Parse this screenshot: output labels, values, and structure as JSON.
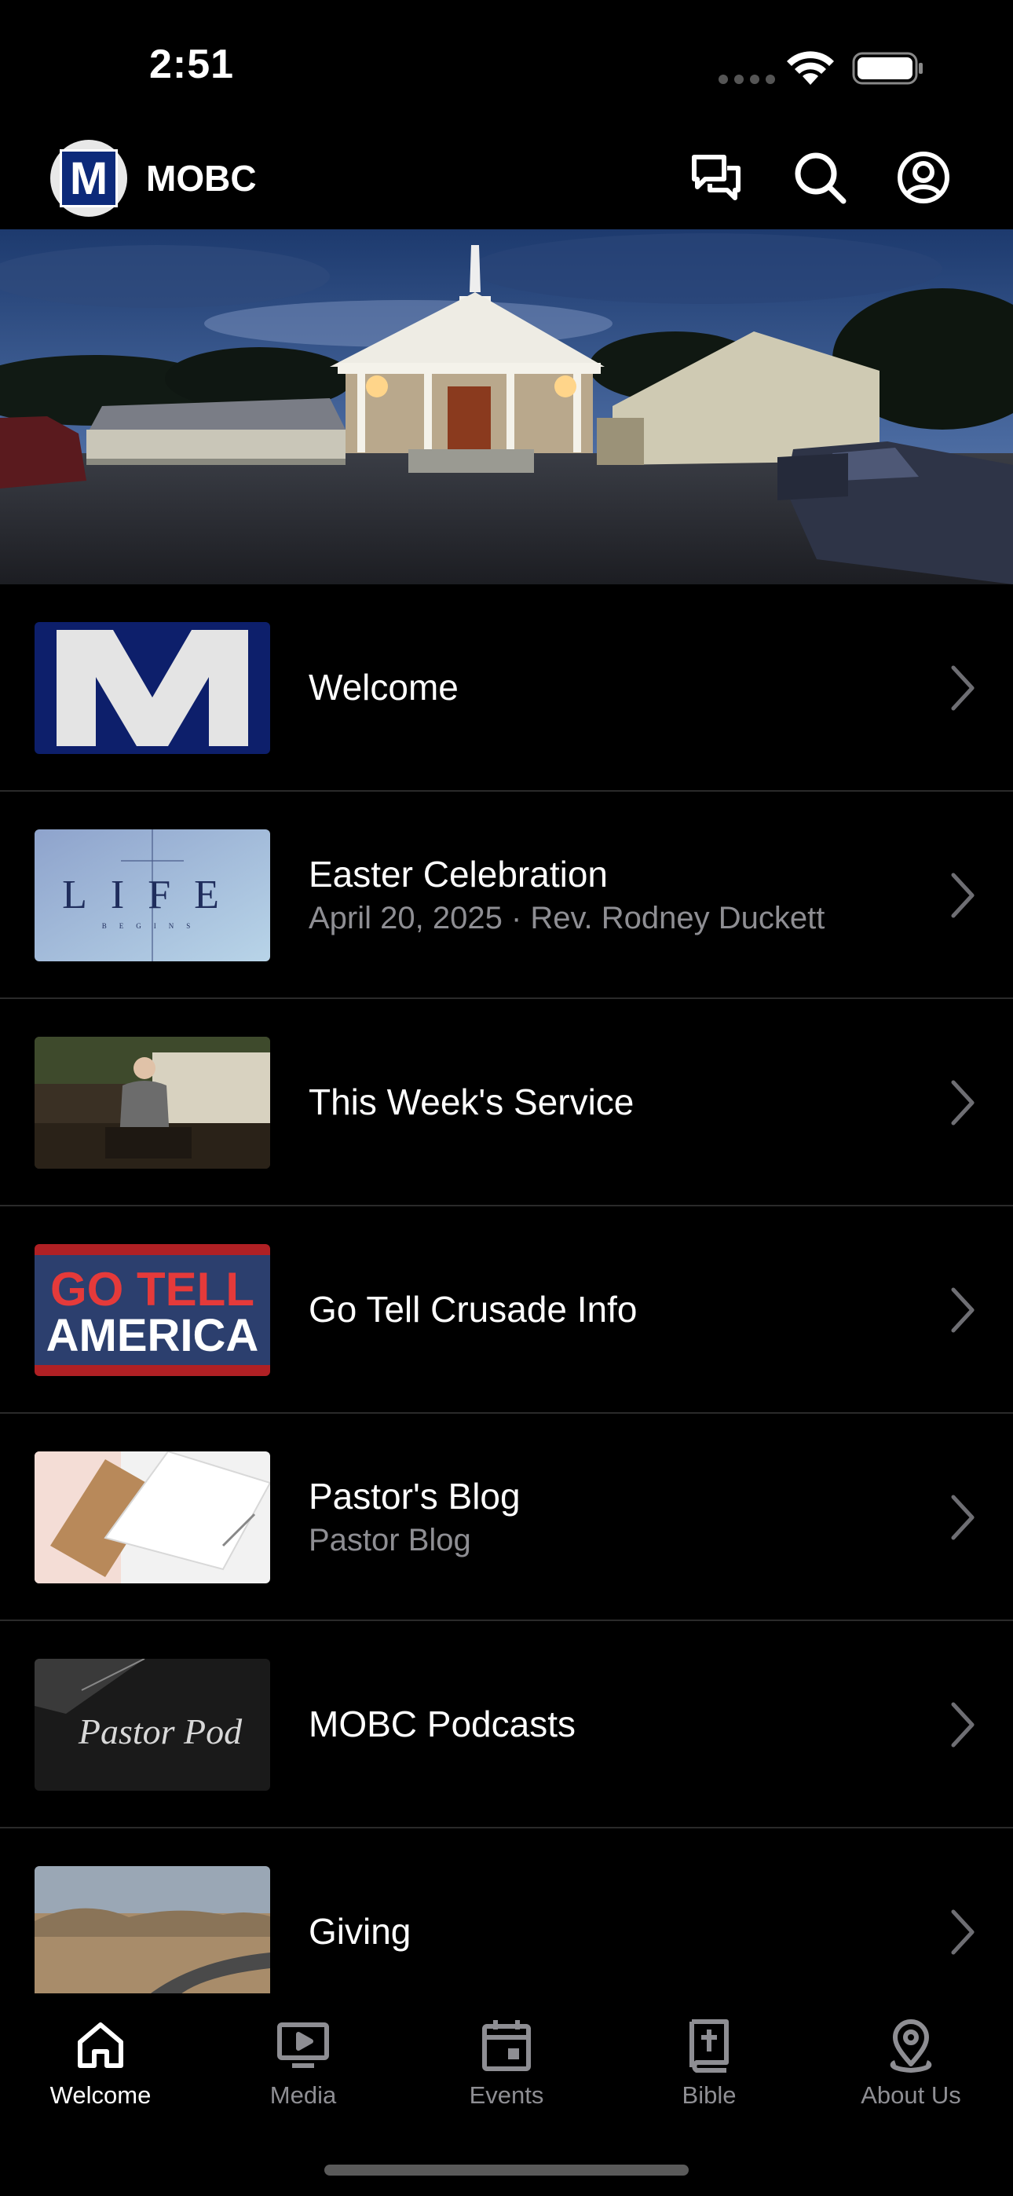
{
  "status": {
    "time": "2:51"
  },
  "header": {
    "logo_letter": "M",
    "title": "MOBC",
    "icons": [
      "chat-icon",
      "search-icon",
      "profile-icon"
    ]
  },
  "list": [
    {
      "title": "Welcome",
      "subtitle": ""
    },
    {
      "title": "Easter Celebration",
      "subtitle": "April 20, 2025 · Rev. Rodney Duckett",
      "thumb_text": "LIFE",
      "thumb_subtext": "BEGINS"
    },
    {
      "title": "This Week's Service",
      "subtitle": ""
    },
    {
      "title": "Go Tell Crusade Info",
      "subtitle": "",
      "thumb_text": "GO TELL",
      "thumb_text2": "AMERICA"
    },
    {
      "title": "Pastor's Blog",
      "subtitle": "Pastor Blog"
    },
    {
      "title": "MOBC Podcasts",
      "subtitle": "",
      "thumb_text": "Pastor Pod"
    },
    {
      "title": "Giving",
      "subtitle": ""
    }
  ],
  "tabs": [
    {
      "label": "Welcome",
      "icon": "home-icon",
      "active": true
    },
    {
      "label": "Media",
      "icon": "tv-play-icon",
      "active": false
    },
    {
      "label": "Events",
      "icon": "calendar-icon",
      "active": false
    },
    {
      "label": "Bible",
      "icon": "bible-icon",
      "active": false
    },
    {
      "label": "About Us",
      "icon": "location-pin-icon",
      "active": false
    }
  ],
  "colors": {
    "background": "#000000",
    "secondary_text": "#8e8e93",
    "separator": "#2a2a2a",
    "brand_blue": "#0d2a7a"
  }
}
